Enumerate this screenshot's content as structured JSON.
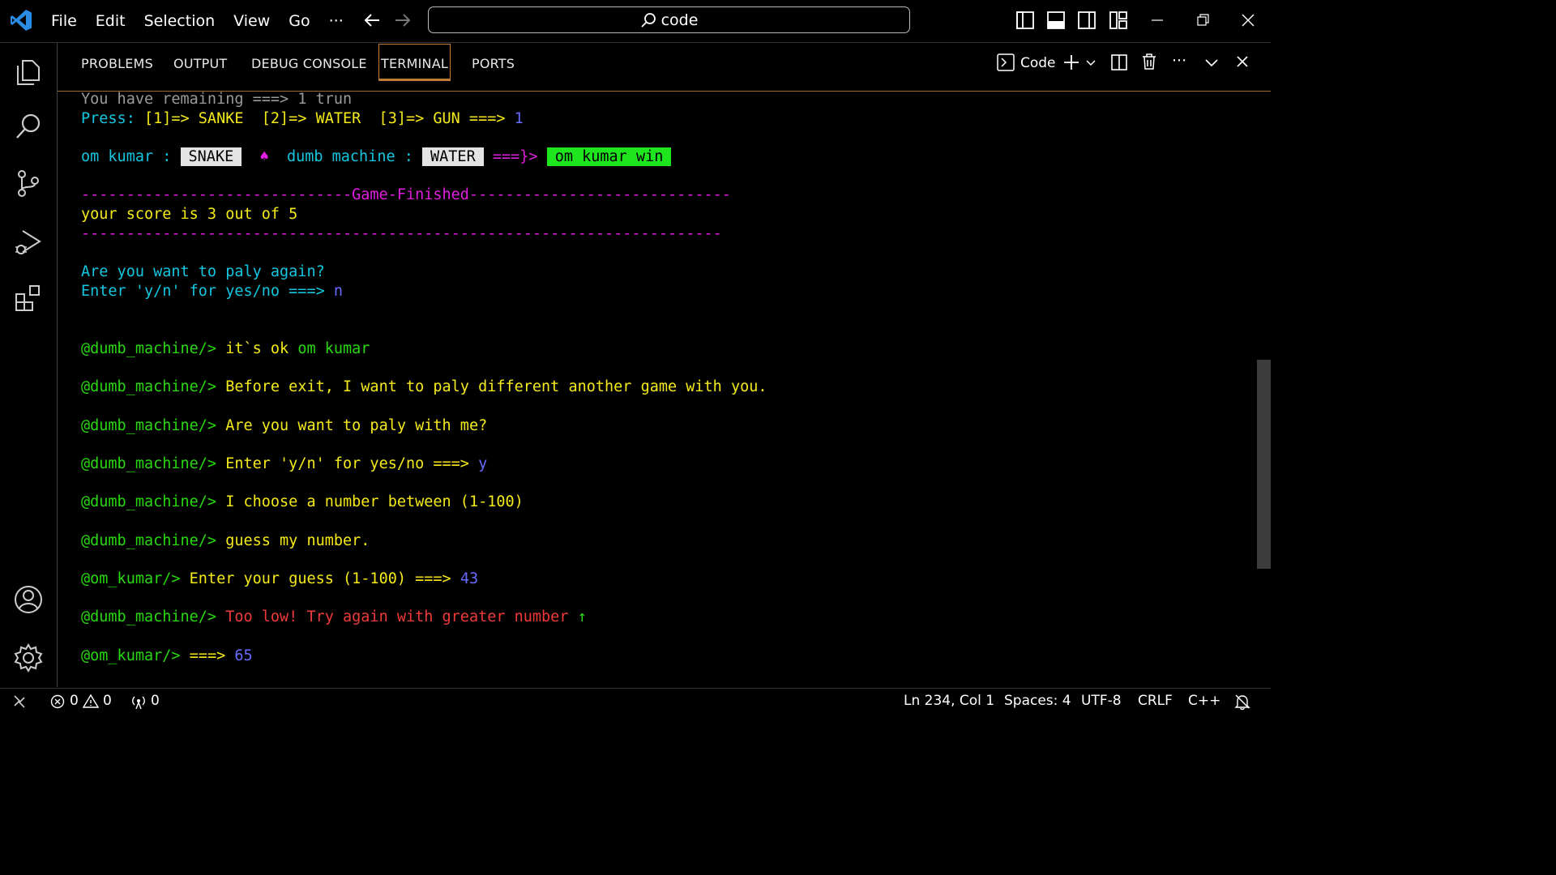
{
  "menu": [
    "File",
    "Edit",
    "Selection",
    "View",
    "Go",
    "···"
  ],
  "search": {
    "label": "code"
  },
  "panel": {
    "tabs": [
      "PROBLEMS",
      "OUTPUT",
      "DEBUG CONSOLE",
      "TERMINAL",
      "PORTS"
    ],
    "active_tab": "TERMINAL",
    "terminal_name": "Code"
  },
  "terminal": {
    "remaining": "You have remaining ===> 1 trun",
    "press_label": "Press:",
    "press_options": "[1]=> SANKE  [2]=> WATER  [3]=> GUN ===>",
    "press_value": "1",
    "player_label": "om kumar :",
    "player_choice": "SNAKE",
    "vs_symbol": "♠",
    "machine_label": "dumb machine :",
    "machine_choice": "WATER",
    "arrow": "===}>",
    "result": "om kumar win",
    "separator_top": "------------------------------Game-Finished-----------------------------",
    "score": "your score is 3 out of 5",
    "separator_bottom": "-----------------------------------------------------------------------",
    "play_again": "Are you want to paly again?",
    "enter_yn_prompt": "Enter 'y/n' for yes/no ===>",
    "enter_yn_value": "n",
    "machine_prompt": "@dumb_machine/>",
    "user_prompt": "@om_kumar/>",
    "msg1_a": "it`s ok",
    "msg1_b": "om kumar",
    "msg2": "Before exit, I want to paly different another game with you.",
    "msg3": "Are you want to paly with me?",
    "msg4": "Enter 'y/n' for yes/no ===>",
    "msg4_value": "y",
    "msg5": "I choose a number between (1-100)",
    "msg6": "guess my number.",
    "guess_prompt": "Enter your guess (1-100) ===>",
    "guess_value": "43",
    "too_low": "Too low! Try again with greater number",
    "up_arrow": "↑",
    "next_prompt": "===>",
    "next_value": "65"
  },
  "status": {
    "errors": "0",
    "warnings": "0",
    "ports": "0",
    "position": "Ln 234, Col 1",
    "spaces": "Spaces: 4",
    "encoding": "UTF-8",
    "eol": "CRLF",
    "language": "C++"
  },
  "colors": {
    "accent": "#c27a3a",
    "vscode_blue": "#2a8ce0"
  }
}
